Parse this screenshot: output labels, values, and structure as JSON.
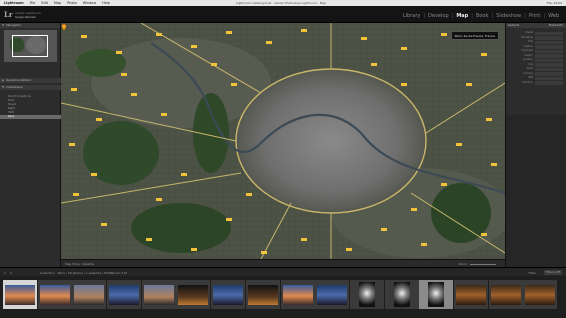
{
  "menubar": {
    "app": "Lightroom",
    "items": [
      "File",
      "Edit",
      "Map",
      "Photo",
      "Window",
      "Help"
    ],
    "window_title": "Lightroom Catalog.lrcat - Adobe Photoshop Lightroom - Map",
    "status": "Thu 14:02"
  },
  "identity": {
    "logo": "Lr",
    "product": "Adobe Lightroom",
    "user": "Serge Ramelli"
  },
  "modules": [
    {
      "label": "Library",
      "active": false
    },
    {
      "label": "Develop",
      "active": false
    },
    {
      "label": "Map",
      "active": true
    },
    {
      "label": "Book",
      "active": false
    },
    {
      "label": "Slideshow",
      "active": false
    },
    {
      "label": "Print",
      "active": false
    },
    {
      "label": "Web",
      "active": false
    }
  ],
  "left_panel": {
    "navigator_title": "Navigator",
    "saved_locations_title": "Saved Locations",
    "collections_title": "Collections",
    "collections": [
      {
        "label": "Smart Collections",
        "count": "",
        "selected": false
      },
      {
        "label": "Paris",
        "count": "",
        "selected": false
      },
      {
        "label": "Street",
        "count": "",
        "selected": false
      },
      {
        "label": "Night",
        "count": "",
        "selected": false
      },
      {
        "label": "HDR",
        "count": "",
        "selected": false
      },
      {
        "label": "Paris",
        "count": "",
        "selected": true
      }
    ]
  },
  "map": {
    "callout": "Paris, Ile-de-France, France",
    "style_label": "Map Style: Satellite",
    "zoom_label": "Zoom"
  },
  "right_panel": {
    "title": "Metadata",
    "preset_label": "Default",
    "fields": [
      "Preset",
      "File Name",
      "Title",
      "Caption",
      "Copyright",
      "Creator",
      "Location",
      "City",
      "State",
      "Country",
      "GPS",
      "Direction"
    ]
  },
  "filmstrip_bar": {
    "nums": [
      "1",
      "2"
    ],
    "crumb": "Collection : Paris / 29 photos / 1 selected / HDRParis2-3.tif",
    "filter_label": "Filter :",
    "filter_value": "Filters Off"
  },
  "thumbnails": [
    {
      "kind": "sunset",
      "selected": true
    },
    {
      "kind": "sunset",
      "selected": false
    },
    {
      "kind": "dusk",
      "selected": false
    },
    {
      "kind": "blue",
      "selected": false
    },
    {
      "kind": "dusk",
      "selected": false
    },
    {
      "kind": "night",
      "selected": false
    },
    {
      "kind": "blue",
      "selected": false
    },
    {
      "kind": "night",
      "selected": false
    },
    {
      "kind": "sunset",
      "selected": false
    },
    {
      "kind": "blue",
      "selected": false
    },
    {
      "kind": "bw",
      "selected": false,
      "portrait": true
    },
    {
      "kind": "bw",
      "selected": false,
      "portrait": true
    },
    {
      "kind": "bw",
      "selected": false,
      "portrait": true,
      "light": true
    },
    {
      "kind": "warm",
      "selected": false
    },
    {
      "kind": "warm",
      "selected": false
    },
    {
      "kind": "warm",
      "selected": false
    }
  ],
  "colors": {
    "map_ring": "#c9b56a",
    "road_label": "#f2c23a",
    "city_core": "#7a7a7a",
    "park": "#2f4a2a",
    "selected_row": "#6a6a6a"
  }
}
